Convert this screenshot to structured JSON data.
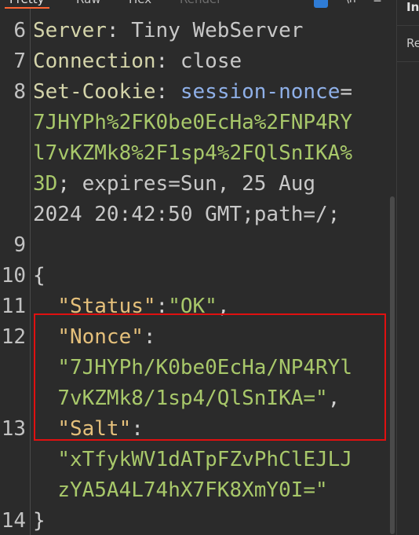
{
  "tabs": [
    {
      "label": "Pretty",
      "state": "active"
    },
    {
      "label": "Raw",
      "state": "normal"
    },
    {
      "label": "Hex",
      "state": "normal"
    },
    {
      "label": "Render",
      "state": "disabled"
    }
  ],
  "toolbar_icons": [
    "wrap-lines-icon",
    "newline-toggle-icon",
    "menu-icon"
  ],
  "right_panel": {
    "title": "In",
    "item": "Re"
  },
  "line_numbers": [
    "6",
    "7",
    "8",
    "9",
    "10",
    "11",
    "12",
    "13",
    "14"
  ],
  "response": {
    "server_name": "Server",
    "server_value": "Tiny WebServer",
    "connection_name": "Connection",
    "connection_value": "close",
    "setcookie_name": "Set-Cookie",
    "cookie_name": "session-nonce",
    "cookie_value_1": "7JHYPh%2FK0be0EcHa%2FNP4RY",
    "cookie_value_2": "l7vKZMk8%2F1sp4%2FQlSnIKA%",
    "cookie_value_3": "3D",
    "cookie_attrs_1": " expires=Sun, 25 Aug",
    "cookie_attrs_2": "2024 20:42:50 GMT;path=/;",
    "brace_open": "{",
    "brace_close": "}",
    "status_key": "\"Status\"",
    "status_value": "\"OK\"",
    "nonce_key": "\"Nonce\"",
    "nonce_value_1": "\"7JHYPh/K0be0EcHa/NP4RYl",
    "nonce_value_2": "7vKZMk8/1sp4/QlSnIKA=\"",
    "salt_key": "\"Salt\"",
    "salt_value_1": "\"xTfykWV1dATpFZvPhClEJLJ",
    "salt_value_2": "zYA5A4L74hX7FK8XmY0I=\""
  },
  "colors": {
    "background": "#2b2b2b",
    "active_tab_underline": "#ff6633",
    "highlight_border": "#e01010",
    "json_key": "#e5c07b",
    "string_value": "#a8c86a",
    "cookie_name": "#8fb0e8"
  }
}
